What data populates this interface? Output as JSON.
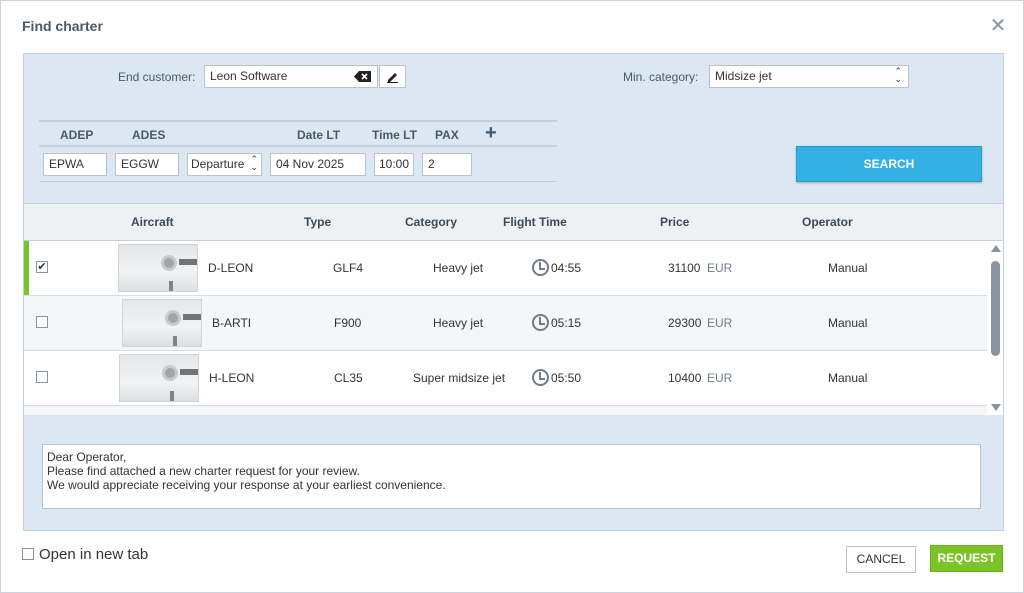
{
  "dialog": {
    "title": "Find charter",
    "close_icon": "close-icon"
  },
  "filters": {
    "end_customer_label": "End customer:",
    "end_customer_value": "Leon Software",
    "clear_icon": "backspace-icon",
    "edit_icon": "pencil-icon",
    "min_category_label": "Min. category:",
    "min_category_value": "Midsize jet"
  },
  "route": {
    "headers": {
      "adep": "ADEP",
      "ades": "ADES",
      "date": "Date LT",
      "time": "Time LT",
      "pax": "PAX"
    },
    "add_icon": "plus-icon",
    "adep": "EPWA",
    "ades": "EGGW",
    "mode": "Departure",
    "date": "04 Nov 2025",
    "time": "10:00",
    "pax": "2"
  },
  "search_label": "SEARCH",
  "results": {
    "columns": {
      "aircraft": "Aircraft",
      "type": "Type",
      "category": "Category",
      "flight_time": "Flight Time",
      "price": "Price",
      "operator": "Operator"
    },
    "rows": [
      {
        "selected": true,
        "checkbox": "✔",
        "reg": "D-LEON",
        "type": "GLF4",
        "category": "Heavy jet",
        "flight_time": "04:55",
        "price": "31100",
        "currency": "EUR",
        "operator": "Manual"
      },
      {
        "selected": false,
        "checkbox": "",
        "reg": "B-ARTI",
        "type": "F900",
        "category": "Heavy jet",
        "flight_time": "05:15",
        "price": "29300",
        "currency": "EUR",
        "operator": "Manual"
      },
      {
        "selected": false,
        "checkbox": "",
        "reg": "H-LEON",
        "type": "CL35",
        "category": "Super midsize jet",
        "flight_time": "05:50",
        "price": "10400",
        "currency": "EUR",
        "operator": "Manual"
      }
    ]
  },
  "message": "Dear Operator,\nPlease find attached a new charter request for your review.\nWe would appreciate receiving your response at your earliest convenience.",
  "footer": {
    "open_new_tab": "Open in new tab",
    "cancel": "CANCEL",
    "request": "REQUEST"
  },
  "colors": {
    "accent_blue": "#33b1e4",
    "accent_green": "#7cc327",
    "panel_bg": "#dbe7f3"
  }
}
